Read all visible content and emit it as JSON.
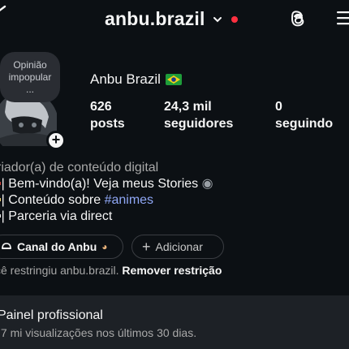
{
  "header": {
    "username": "anbu.brazil",
    "threads_icon": "threads-icon",
    "menu_icon": "hamburger-menu-icon",
    "notification_dot_color": "#ff3040"
  },
  "note": {
    "line1": "Opinião",
    "line2": "impopular",
    "line3": "..."
  },
  "profile": {
    "display_name": "Anbu Brazil",
    "flag_icon": "brazil-flag-icon",
    "posts_count": "626",
    "posts_label": "posts",
    "followers_count": "24,3 mil",
    "followers_label": "seguidores",
    "following_count": "0",
    "following_label": "seguindo"
  },
  "bio": {
    "category": "riador(a) de conteúdo digital",
    "line1": "| Bem-vindo(a)! Veja meus Stories",
    "line2_text": "| Conteúdo sobre ",
    "line2_hashtag": "#animes",
    "line3": "| Parceria via direct",
    "hashtag_color": "#8fa7f5"
  },
  "actions": {
    "channel_label": "Canal do Anbu",
    "add_label": "Adicionar"
  },
  "restriction": {
    "text": "cê restringiu anbu.brazil.",
    "action": "Remover restrição"
  },
  "pro_panel": {
    "title": "Painel profissional",
    "subtitle": ",7 mi visualizações nos últimos 30 dias."
  }
}
